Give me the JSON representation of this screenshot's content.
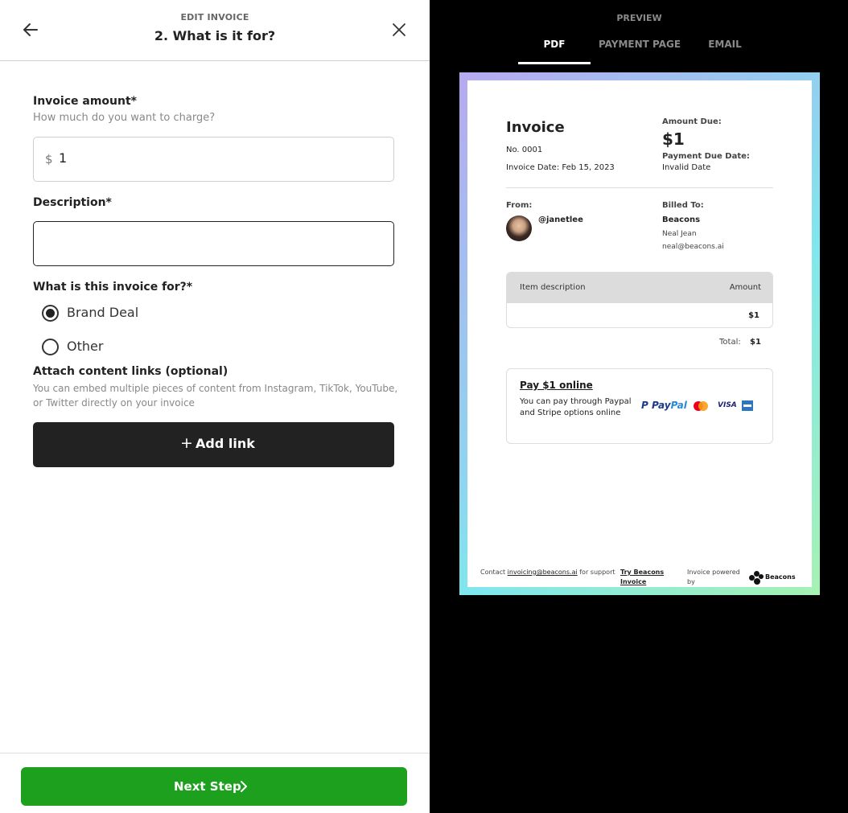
{
  "header": {
    "eyebrow": "EDIT INVOICE",
    "title": "2. What is it for?"
  },
  "form": {
    "amount_label": "Invoice amount*",
    "amount_sub": "How much do you want to charge?",
    "currency_symbol": "$",
    "amount_value": "1",
    "description_label": "Description*",
    "description_value": "",
    "purpose_label": "What is this invoice for?*",
    "options": [
      {
        "label": "Brand Deal",
        "selected": true
      },
      {
        "label": "Other",
        "selected": false
      }
    ],
    "attach_label": "Attach content links (optional)",
    "attach_sub": "You can embed multiple pieces of content from Instagram, TikTok, YouTube, or Twitter directly on your invoice",
    "add_link_label": "Add link"
  },
  "footer": {
    "next_label": "Next Step"
  },
  "preview": {
    "title": "PREVIEW",
    "tabs": [
      "PDF",
      "PAYMENT PAGE",
      "EMAIL"
    ],
    "active_tab": "PDF"
  },
  "invoice": {
    "title": "Invoice",
    "number": "No. 0001",
    "date": "Invoice Date: Feb 15, 2023",
    "amount_due_label": "Amount Due:",
    "amount_due": "$1",
    "due_date_label": "Payment Due Date:",
    "due_date": "Invalid Date",
    "from_label": "From:",
    "from_handle": "@janetlee",
    "billed_label": "Billed To:",
    "billed_name": "Beacons",
    "billed_person": "Neal Jean",
    "billed_email": "neal@beacons.ai",
    "items_header_desc": "Item description",
    "items_header_amount": "Amount",
    "item_amount": "$1",
    "total_label": "Total:",
    "total_value": "$1",
    "pay_title": "Pay $1 online",
    "pay_desc": "You can pay through Paypal and Stripe options online",
    "paypal_a": "P Pay",
    "paypal_b": "Pal",
    "visa": "VISA",
    "footer_contact_a": "Contact",
    "footer_contact_email": "invoicing@beacons.ai",
    "footer_contact_b": "for support",
    "footer_try": "Try Beacons Invoice",
    "footer_powered": "Invoice powered by",
    "footer_brand": "Beacons"
  },
  "colors": {
    "primary_button": "#1da01d",
    "dark_button": "#222222",
    "preview_bg": "#000000"
  }
}
